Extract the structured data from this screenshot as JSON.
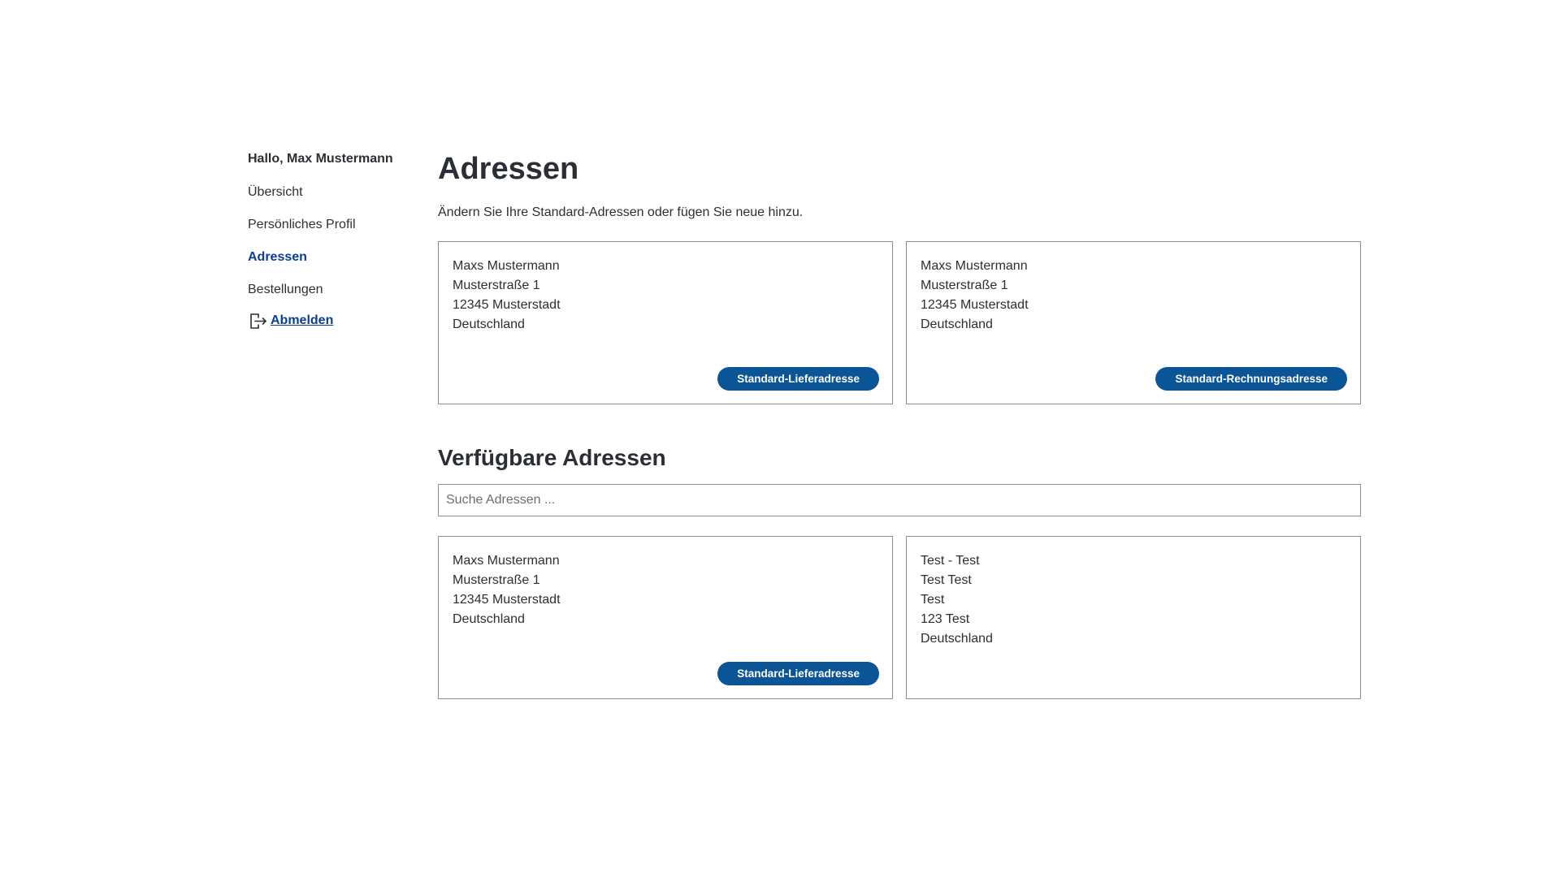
{
  "sidebar": {
    "greeting": "Hallo, Max Mustermann",
    "items": [
      {
        "label": "Übersicht"
      },
      {
        "label": "Persönliches Profil"
      },
      {
        "label": "Adressen"
      },
      {
        "label": "Bestellungen"
      }
    ],
    "logout_label": "Abmelden",
    "logout_icon": "logout-icon"
  },
  "main": {
    "title": "Adressen",
    "subtitle": "Ändern Sie Ihre Standard-Adressen oder fügen Sie neue hinzu.",
    "default_addresses": [
      {
        "lines": [
          "Maxs Mustermann",
          "Musterstraße 1",
          "12345 Musterstadt",
          "Deutschland"
        ],
        "badge": "Standard-Lieferadresse"
      },
      {
        "lines": [
          "Maxs Mustermann",
          "Musterstraße 1",
          "12345 Musterstadt",
          "Deutschland"
        ],
        "badge": "Standard-Rechnungsadresse"
      }
    ],
    "available_title": "Verfügbare Adressen",
    "search": {
      "placeholder": "Suche Adressen ...",
      "value": ""
    },
    "available_addresses": [
      {
        "lines": [
          "Maxs Mustermann",
          "Musterstraße 1",
          "12345 Musterstadt",
          "Deutschland"
        ],
        "badge": "Standard-Lieferadresse"
      },
      {
        "lines": [
          "Test - Test",
          "Test Test",
          "Test",
          "123 Test",
          "Deutschland"
        ],
        "badge": null
      }
    ]
  },
  "colors": {
    "accent": "#0b3f91",
    "badge_bg": "#0b5596",
    "text": "#2b2f35",
    "border": "#8a8d91"
  }
}
